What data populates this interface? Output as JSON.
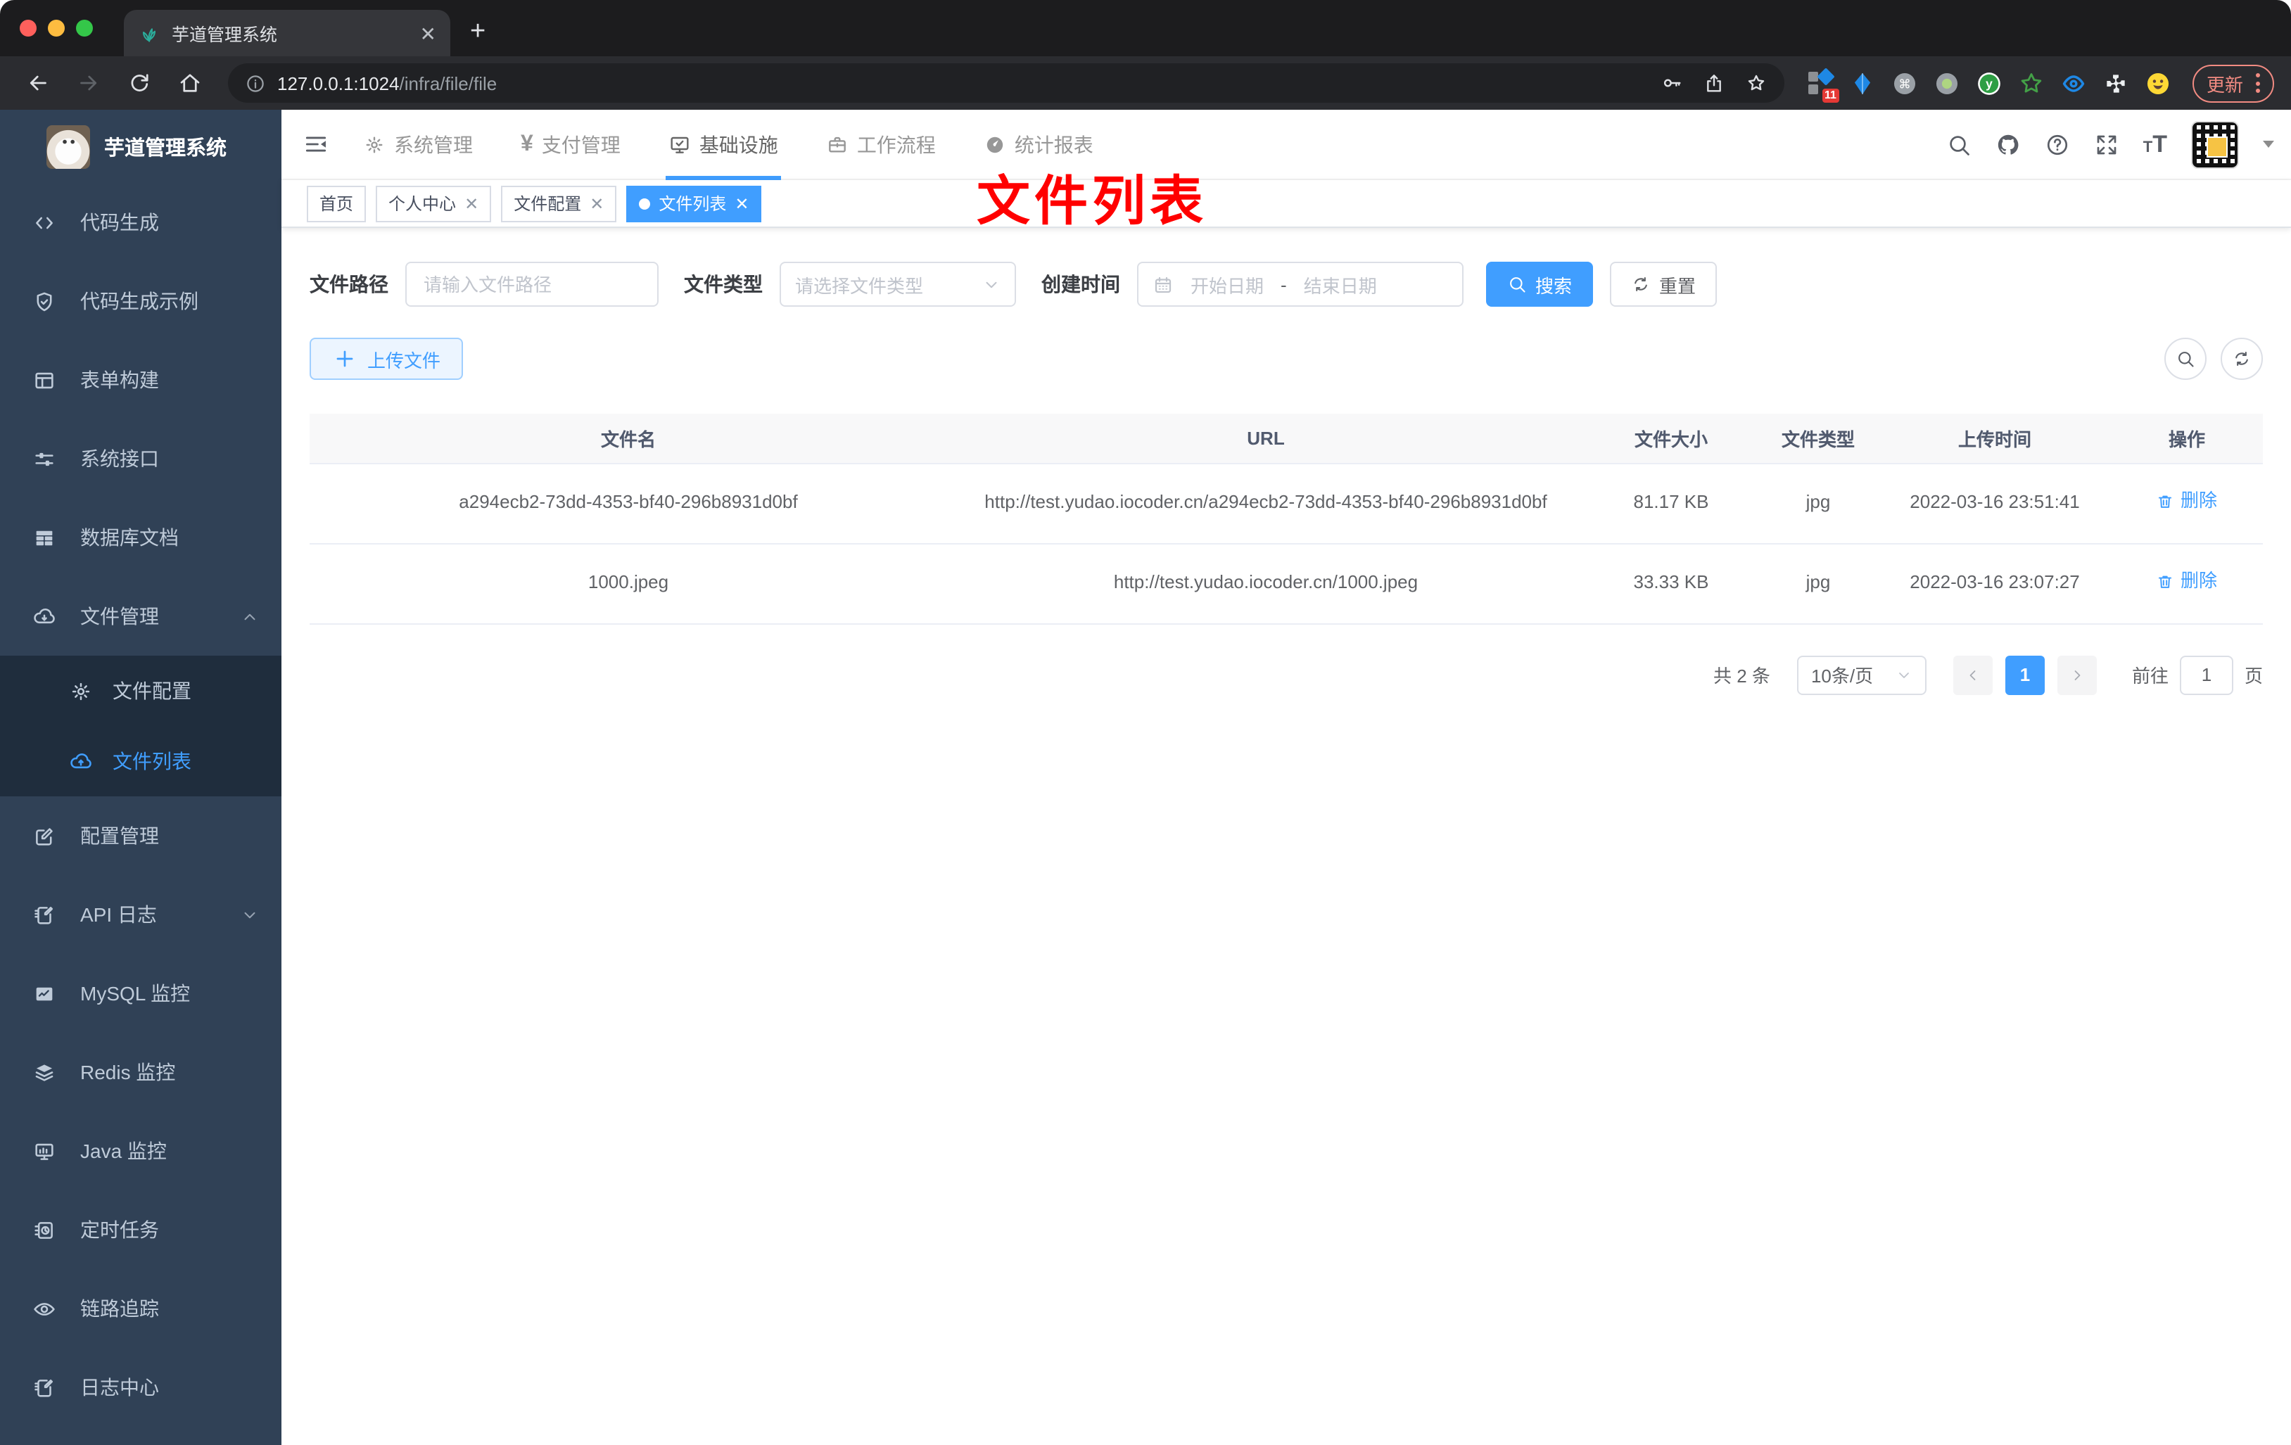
{
  "browser": {
    "tab_title": "芋道管理系统",
    "url_host": "127.0.0.1:1024",
    "url_path": "/infra/file/file",
    "extension_badge": "11",
    "update_label": "更新"
  },
  "sidebar": {
    "title": "芋道管理系统",
    "group1": [
      "代码生成",
      "代码生成示例",
      "表单构建",
      "系统接口",
      "数据库文档",
      "文件管理"
    ],
    "submenu": [
      "文件配置",
      "文件列表"
    ],
    "group2": [
      "配置管理",
      "API 日志",
      "MySQL 监控",
      "Redis 监控",
      "Java 监控",
      "定时任务",
      "链路追踪",
      "日志中心"
    ]
  },
  "topnav": {
    "items": [
      "系统管理",
      "支付管理",
      "基础设施",
      "工作流程",
      "统计报表"
    ],
    "payment_icon_glyph": "¥"
  },
  "tags": {
    "items": [
      "首页",
      "个人中心",
      "文件配置",
      "文件列表"
    ]
  },
  "annotation": {
    "text": "文件列表",
    "color": "#ff0000"
  },
  "filters": {
    "path_label": "文件路径",
    "path_placeholder": "请输入文件路径",
    "type_label": "文件类型",
    "type_placeholder": "请选择文件类型",
    "date_label": "创建时间",
    "date_start": "开始日期",
    "date_separator": "-",
    "date_end": "结束日期",
    "search_label": "搜索",
    "reset_label": "重置"
  },
  "toolbar": {
    "upload_label": "上传文件"
  },
  "table": {
    "columns": [
      "文件名",
      "URL",
      "文件大小",
      "文件类型",
      "上传时间",
      "操作"
    ],
    "rows": [
      {
        "name": "a294ecb2-73dd-4353-bf40-296b8931d0bf",
        "url": "http://test.yudao.iocoder.cn/a294ecb2-73dd-4353-bf40-296b8931d0bf",
        "size": "81.17 KB",
        "type": "jpg",
        "time": "2022-03-16 23:51:41",
        "action": "删除"
      },
      {
        "name": "1000.jpeg",
        "url": "http://test.yudao.iocoder.cn/1000.jpeg",
        "size": "33.33 KB",
        "type": "jpg",
        "time": "2022-03-16 23:07:27",
        "action": "删除"
      }
    ]
  },
  "pagination": {
    "total": "共 2 条",
    "page_size": "10条/页",
    "page": "1",
    "goto_label": "前往",
    "goto_value": "1",
    "unit_label": "页"
  },
  "colors": {
    "primary": "#409eff",
    "sidebar_bg": "#304156",
    "submenu_bg": "#1f2d3d",
    "annotation": "#ff0000",
    "update_pill": "#f28b82"
  }
}
